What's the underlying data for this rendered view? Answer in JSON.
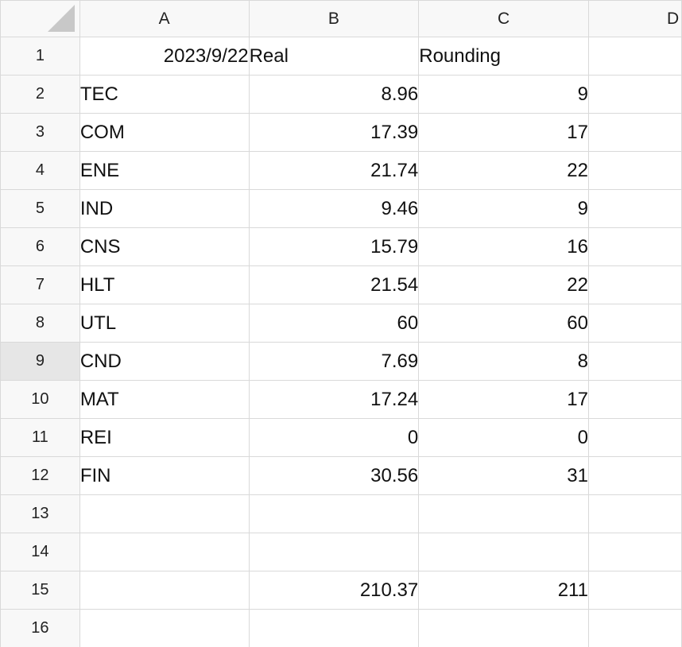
{
  "columns": [
    "A",
    "B",
    "C",
    "D"
  ],
  "rows": [
    {
      "num": "1",
      "A": "2023/9/22",
      "B": "Real",
      "C": "Rounding"
    },
    {
      "num": "2",
      "A": "TEC",
      "B": "8.96",
      "C": "9"
    },
    {
      "num": "3",
      "A": "COM",
      "B": "17.39",
      "C": "17"
    },
    {
      "num": "4",
      "A": "ENE",
      "B": "21.74",
      "C": "22"
    },
    {
      "num": "5",
      "A": "IND",
      "B": "9.46",
      "C": "9"
    },
    {
      "num": "6",
      "A": "CNS",
      "B": "15.79",
      "C": "16"
    },
    {
      "num": "7",
      "A": "HLT",
      "B": "21.54",
      "C": "22"
    },
    {
      "num": "8",
      "A": "UTL",
      "B": "60",
      "C": "60"
    },
    {
      "num": "9",
      "A": "CND",
      "B": "7.69",
      "C": "8"
    },
    {
      "num": "10",
      "A": "MAT",
      "B": "17.24",
      "C": "17"
    },
    {
      "num": "11",
      "A": "REI",
      "B": "0",
      "C": "0"
    },
    {
      "num": "12",
      "A": "FIN",
      "B": "30.56",
      "C": "31"
    },
    {
      "num": "13",
      "A": "",
      "B": "",
      "C": ""
    },
    {
      "num": "14",
      "A": "",
      "B": "",
      "C": ""
    },
    {
      "num": "15",
      "A": "",
      "B": "210.37",
      "C": "211"
    },
    {
      "num": "16",
      "A": "",
      "B": "",
      "C": ""
    }
  ],
  "selection": {
    "row": "9",
    "column": "A"
  },
  "colors": {
    "selection_accent": "#4a86e8",
    "header_bg": "#f8f8f8",
    "gridline": "#d9d9d9"
  }
}
